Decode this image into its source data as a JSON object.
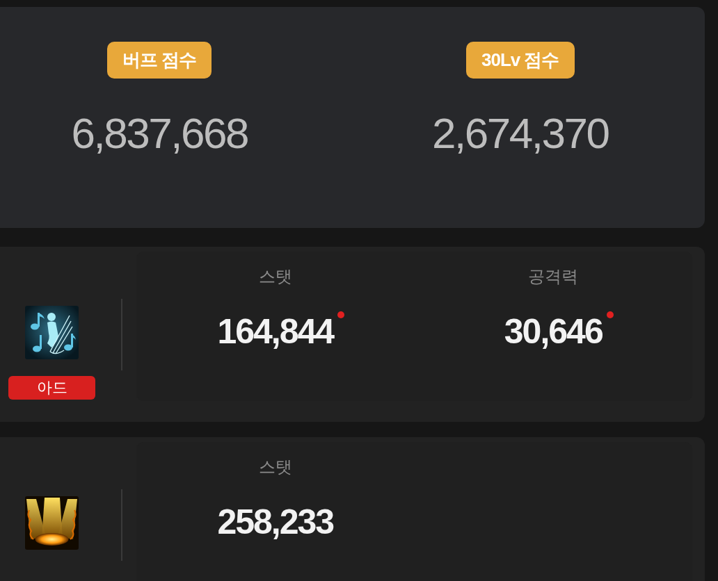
{
  "scores": [
    {
      "label": "버프 점수",
      "value": "6,837,668"
    },
    {
      "label": "30Lv 점수",
      "value": "2,674,370"
    }
  ],
  "skills": [
    {
      "kind": "music",
      "tag": "아드",
      "stats": [
        {
          "label": "스탯",
          "value": "164,844",
          "alert": true
        },
        {
          "label": "공격력",
          "value": "30,646",
          "alert": true
        }
      ]
    },
    {
      "kind": "light",
      "stats": [
        {
          "label": "스탯",
          "value": "258,233",
          "alert": false
        }
      ]
    }
  ]
}
